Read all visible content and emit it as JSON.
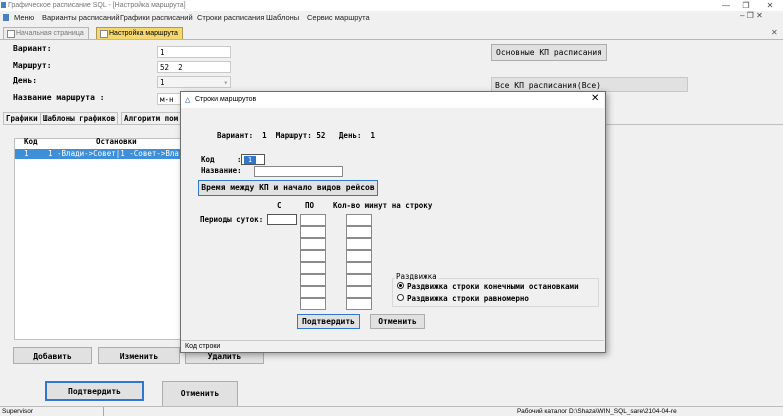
{
  "window": {
    "title": "Графическое расписание SQL - [Настройка маршрута]"
  },
  "menu": [
    "Меню",
    "Варианты расписаний",
    "Графики расписаний",
    "Строки расписания",
    "Шаблоны",
    "Сервис маршрута"
  ],
  "doc_tabs": {
    "home": "Начальная страница",
    "active": "Настройка маршрута"
  },
  "form": {
    "variant_label": "Вариант:",
    "variant_value": "1",
    "route_label": "Маршрут:",
    "route_value": "52",
    "route_value2": "2",
    "day_label": "День:",
    "day_value": "1",
    "route_name_label": "Название маршрута :",
    "route_name_value": "м-н",
    "main_kp_button": "Основные КП расписания",
    "all_kp_label": "Все КП расписания(Все)"
  },
  "sub_tabs": [
    "Графики",
    "Шаблоны графиков",
    "Алгоритм пом"
  ],
  "grid": {
    "columns": [
      "Код",
      "Остановки"
    ],
    "rows": [
      {
        "code": "1",
        "stops": "1 -Влади->Совет|1 -Совет->Вла"
      }
    ]
  },
  "bottom_buttons": {
    "add": "Добавить",
    "edit": "Изменить",
    "delete": "Удалить"
  },
  "page_buttons": {
    "confirm": "Подтвердить",
    "cancel": "Отменить"
  },
  "dialog": {
    "title": "Строки маршрутов",
    "header": "Вариант:  1  Маршрут: 52   День:  1",
    "code_label": "Код",
    "code_colon": ":",
    "code_value": "1",
    "name_label": "Название:",
    "time_button": "Время между КП и начало видов рейсов",
    "col_from": "С",
    "col_to": "ПО",
    "col_minutes": "Кол-во минут на строку",
    "periods_label": "Периоды суток:",
    "spread_group": "Раздвижка",
    "radio1": "Раздвижка строки конечными остановками",
    "radio2": "Раздвижка строки равномерно",
    "confirm": "Подтвердить",
    "cancel": "Отменить",
    "status": "Код строки"
  },
  "statusbar": {
    "user": "Supervisor",
    "path": "Рабочий каталог D:\\Shaza\\WIN_SQL_sare\\2104-04-re"
  },
  "colors": {
    "active_tab": "#f5d770",
    "selected_row": "#3e8fd8",
    "focus_blue": "#3377cc"
  }
}
